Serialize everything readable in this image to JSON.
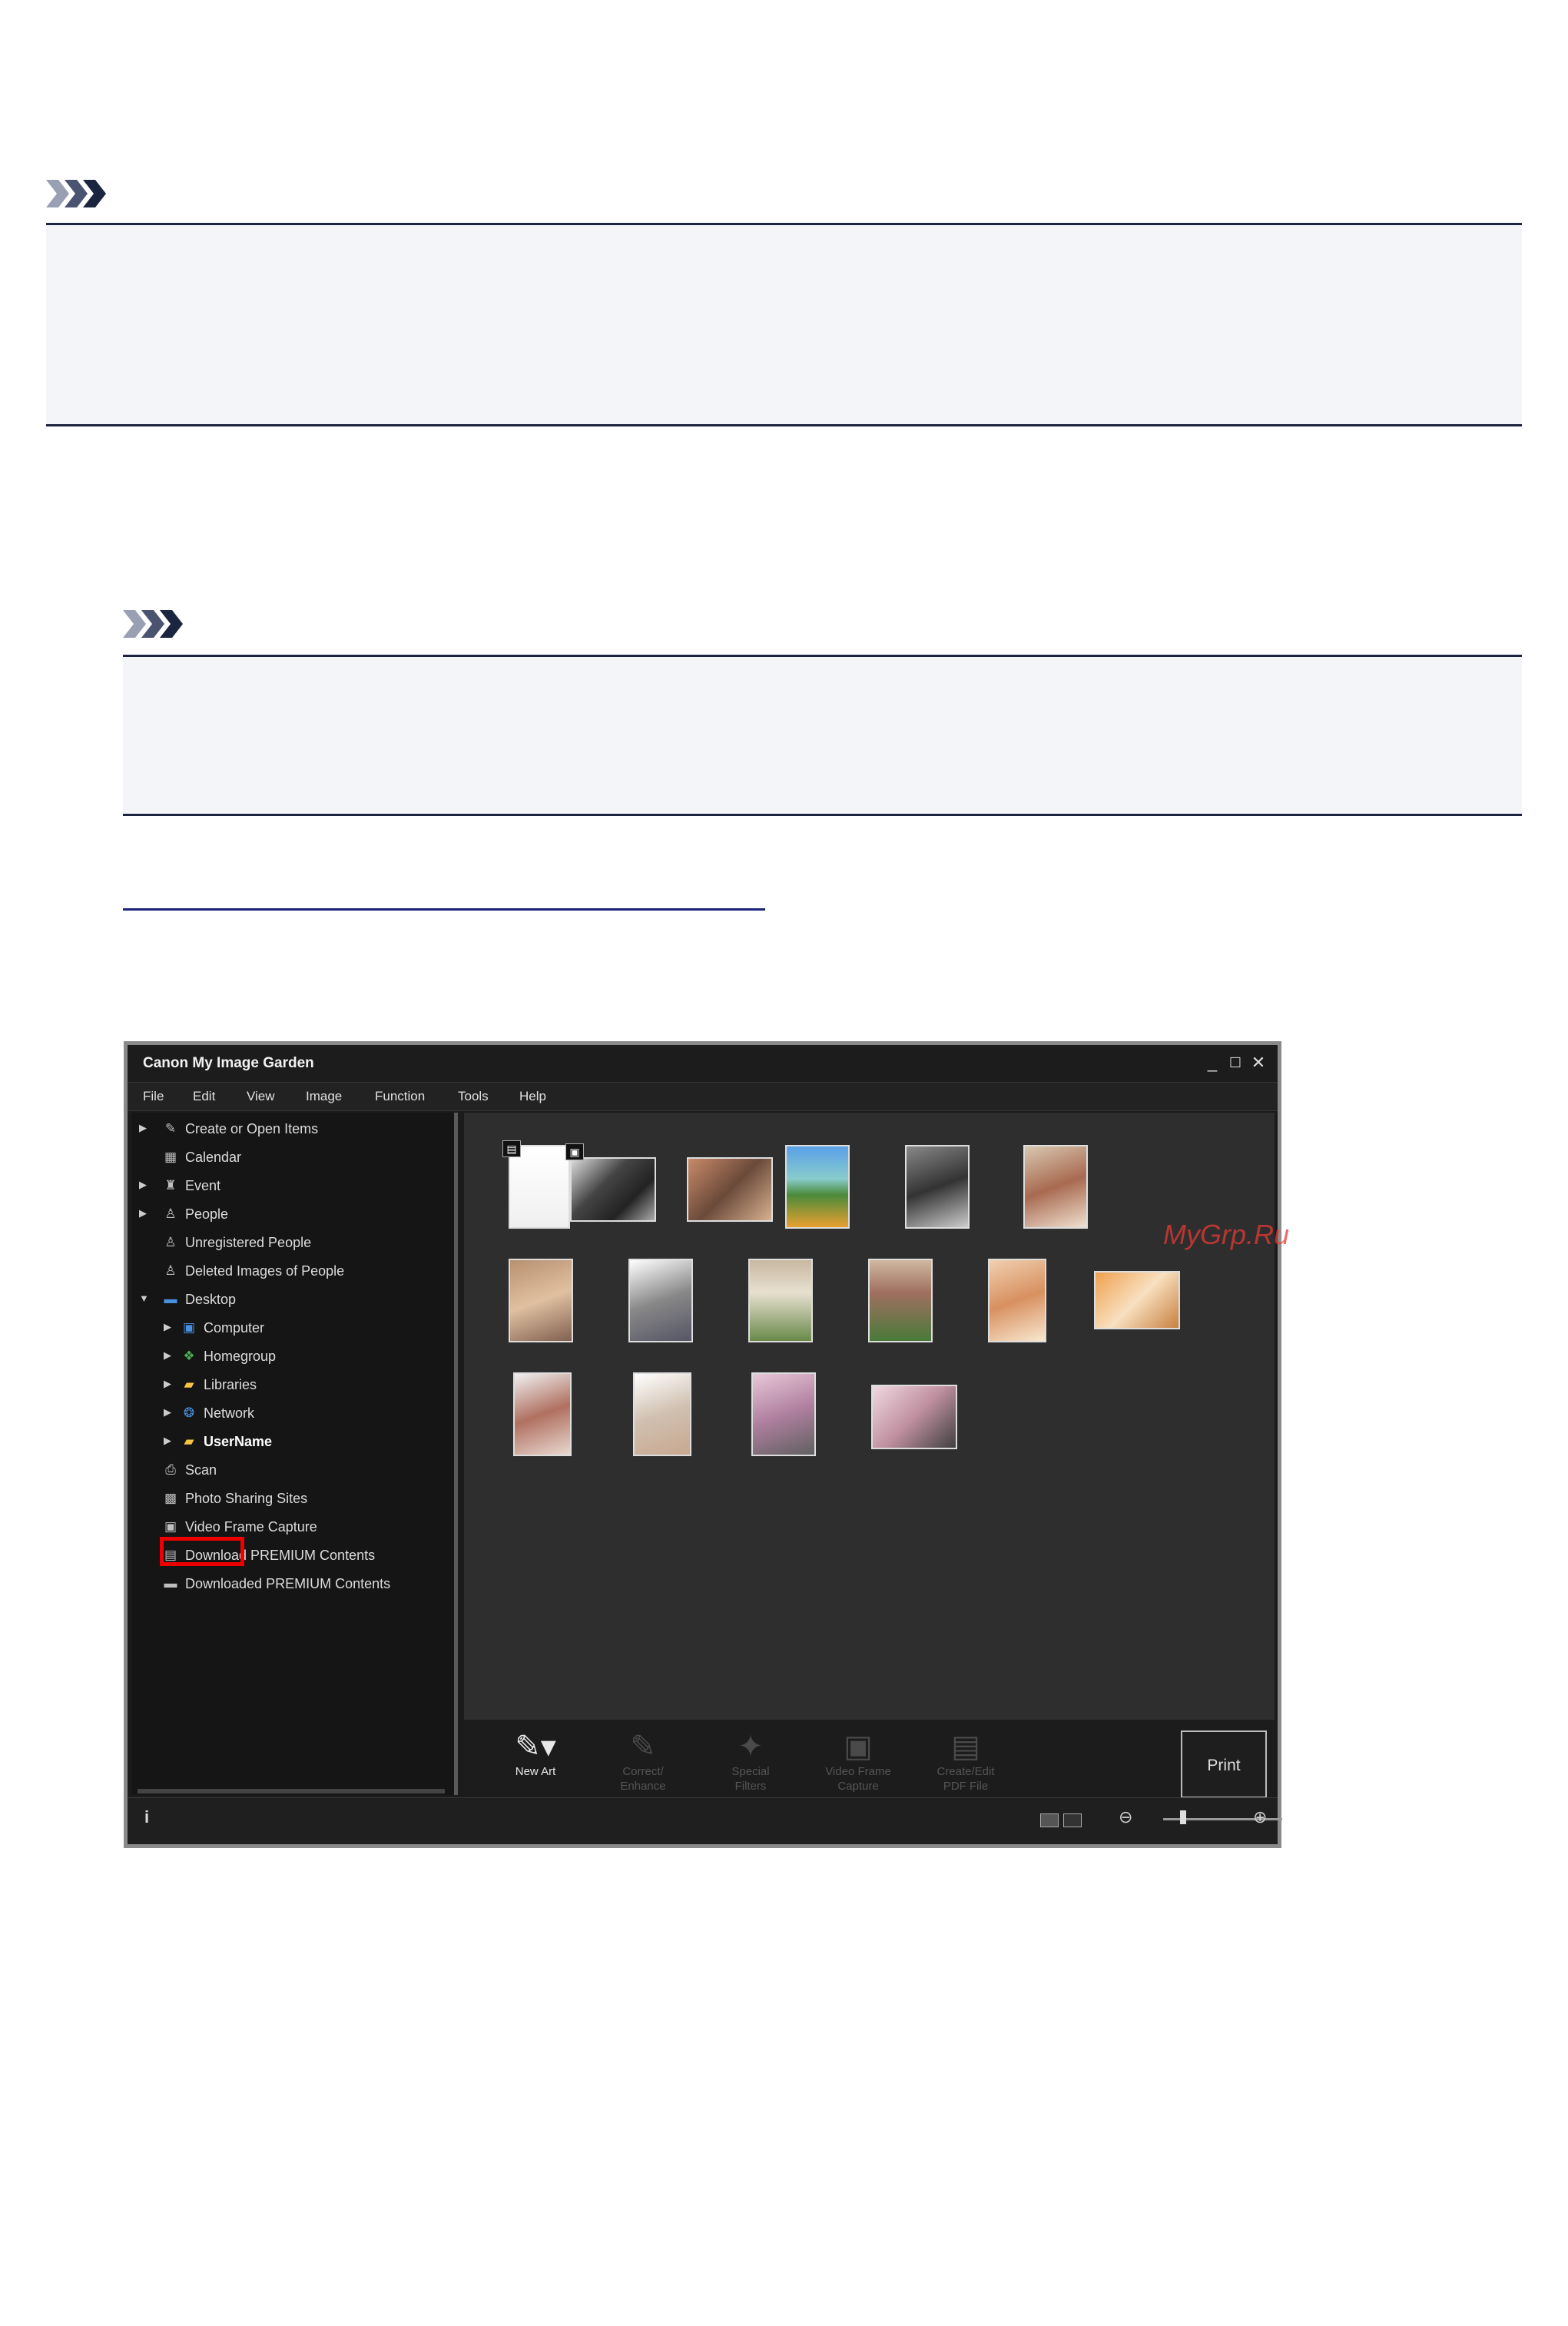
{
  "app": {
    "title": "Canon My Image Garden",
    "window_controls": {
      "minimize": "_",
      "maximize": "☐",
      "close": "✕"
    },
    "menu": [
      "File",
      "Edit",
      "View",
      "Image",
      "Function",
      "Tools",
      "Help"
    ],
    "sidebar": [
      {
        "label": "Create or Open Items",
        "icon": "create-icon",
        "arrow": "▶"
      },
      {
        "label": "Calendar",
        "icon": "calendar-icon",
        "arrow": ""
      },
      {
        "label": "Event",
        "icon": "event-icon",
        "arrow": "▶"
      },
      {
        "label": "People",
        "icon": "people-icon",
        "arrow": "▶"
      },
      {
        "label": "Unregistered People",
        "icon": "unregistered-people-icon",
        "arrow": ""
      },
      {
        "label": "Deleted Images of People",
        "icon": "deleted-people-icon",
        "arrow": ""
      },
      {
        "label": "Desktop",
        "icon": "desktop-icon",
        "arrow": "▼"
      },
      {
        "label": "Computer",
        "icon": "computer-icon",
        "arrow": "▶"
      },
      {
        "label": "Homegroup",
        "icon": "homegroup-icon",
        "arrow": "▶"
      },
      {
        "label": "Libraries",
        "icon": "libraries-icon",
        "arrow": "▶"
      },
      {
        "label": "Network",
        "icon": "network-icon",
        "arrow": "▶"
      },
      {
        "label": "UserName",
        "icon": "user-folder-icon",
        "arrow": "▶"
      },
      {
        "label": "Scan",
        "icon": "scan-icon",
        "arrow": ""
      },
      {
        "label": "Photo Sharing Sites",
        "icon": "photo-sharing-icon",
        "arrow": ""
      },
      {
        "label": "Video Frame Capture",
        "icon": "video-frame-icon",
        "arrow": ""
      },
      {
        "label": "Download PREMIUM Contents",
        "icon": "download-premium-icon",
        "arrow": ""
      },
      {
        "label": "Downloaded PREMIUM Contents",
        "icon": "downloaded-premium-icon",
        "arrow": ""
      }
    ],
    "toolbar": [
      {
        "label1": "New Art",
        "label2": "",
        "icon": "new-art-icon",
        "glyph": "✎",
        "enabled": true
      },
      {
        "label1": "Correct/",
        "label2": "Enhance",
        "icon": "correct-enhance-icon",
        "glyph": "✎",
        "enabled": false
      },
      {
        "label1": "Special",
        "label2": "Filters",
        "icon": "special-filters-icon",
        "glyph": "✦",
        "enabled": false
      },
      {
        "label1": "Video Frame",
        "label2": "Capture",
        "icon": "video-frame-capture-icon",
        "glyph": "▣",
        "enabled": false
      },
      {
        "label1": "Create/Edit",
        "label2": "PDF File",
        "icon": "pdf-file-icon",
        "glyph": "▤",
        "enabled": false
      }
    ],
    "print_label": "Print",
    "status": {
      "info": "i",
      "zoom_out": "⊖",
      "zoom_in": "⊕"
    },
    "watermark": "MyGrp.Ru"
  }
}
